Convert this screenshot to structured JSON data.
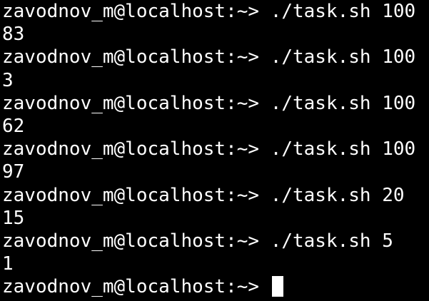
{
  "terminal": {
    "colors": {
      "background": "#000000",
      "foreground": "#ffffff",
      "cursor": "#ffffff"
    },
    "prompt": "zavodnov_m@localhost:~> ",
    "entries": [
      {
        "command": "./task.sh 100",
        "output": "83"
      },
      {
        "command": "./task.sh 100",
        "output": "3"
      },
      {
        "command": "./task.sh 100",
        "output": "62"
      },
      {
        "command": "./task.sh 100",
        "output": "97"
      },
      {
        "command": "./task.sh 20",
        "output": "15"
      },
      {
        "command": "./task.sh 5",
        "output": "1"
      }
    ],
    "current_input": ""
  }
}
